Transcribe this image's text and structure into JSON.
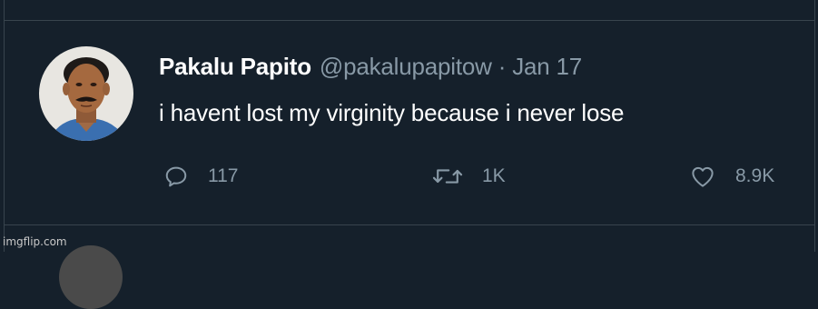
{
  "tweet": {
    "display_name": "Pakalu Papito",
    "handle": "@pakalupapitow",
    "separator": "·",
    "date": "Jan 17",
    "text": "i havent lost my virginity because i never lose",
    "actions": {
      "reply_count": "117",
      "retweet_count": "1K",
      "like_count": "8.9K"
    }
  },
  "watermark": "imgflip.com",
  "icons": {
    "reply": "reply-icon",
    "retweet": "retweet-icon",
    "like": "heart-icon"
  },
  "colors": {
    "background": "#15202b",
    "border": "#38444d",
    "secondary_text": "#8899a6",
    "primary_text": "#ffffff"
  }
}
